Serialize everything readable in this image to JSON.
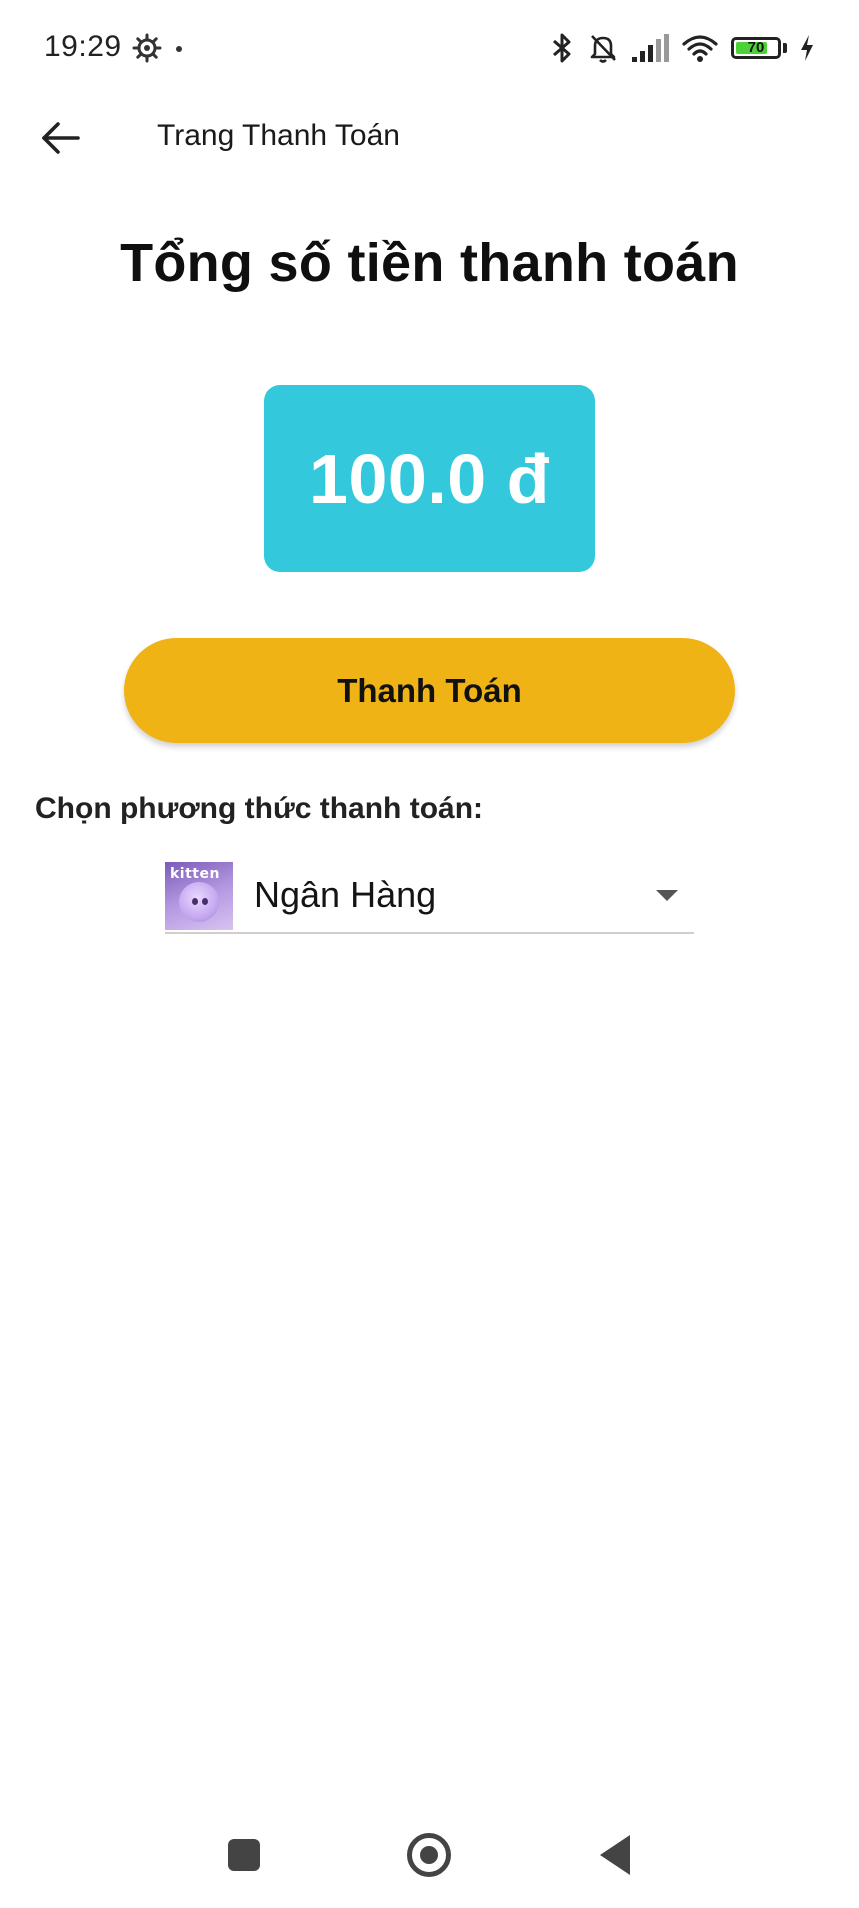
{
  "status_bar": {
    "time": "19:29",
    "battery_level": "70",
    "icons": [
      "settings-gear-icon",
      "bluetooth-icon",
      "mute-bell-icon",
      "signal-icon",
      "wifi-icon",
      "battery-icon",
      "charging-icon"
    ]
  },
  "app_bar": {
    "title": "Trang Thanh Toán",
    "back_icon": "arrow-left-icon"
  },
  "main": {
    "heading": "Tổng số tiền thanh toán",
    "amount": "100.0 đ",
    "pay_button_label": "Thanh Toán",
    "method_prompt": "Chọn phương thức thanh toán:",
    "method_selected": "Ngân Hàng",
    "method_thumb_text": "kitten"
  },
  "colors": {
    "amount_box": "#33c8dc",
    "pay_button": "#efb316"
  },
  "nav_bar": {
    "icons": [
      "recents-square-icon",
      "home-circle-icon",
      "back-triangle-icon"
    ]
  }
}
